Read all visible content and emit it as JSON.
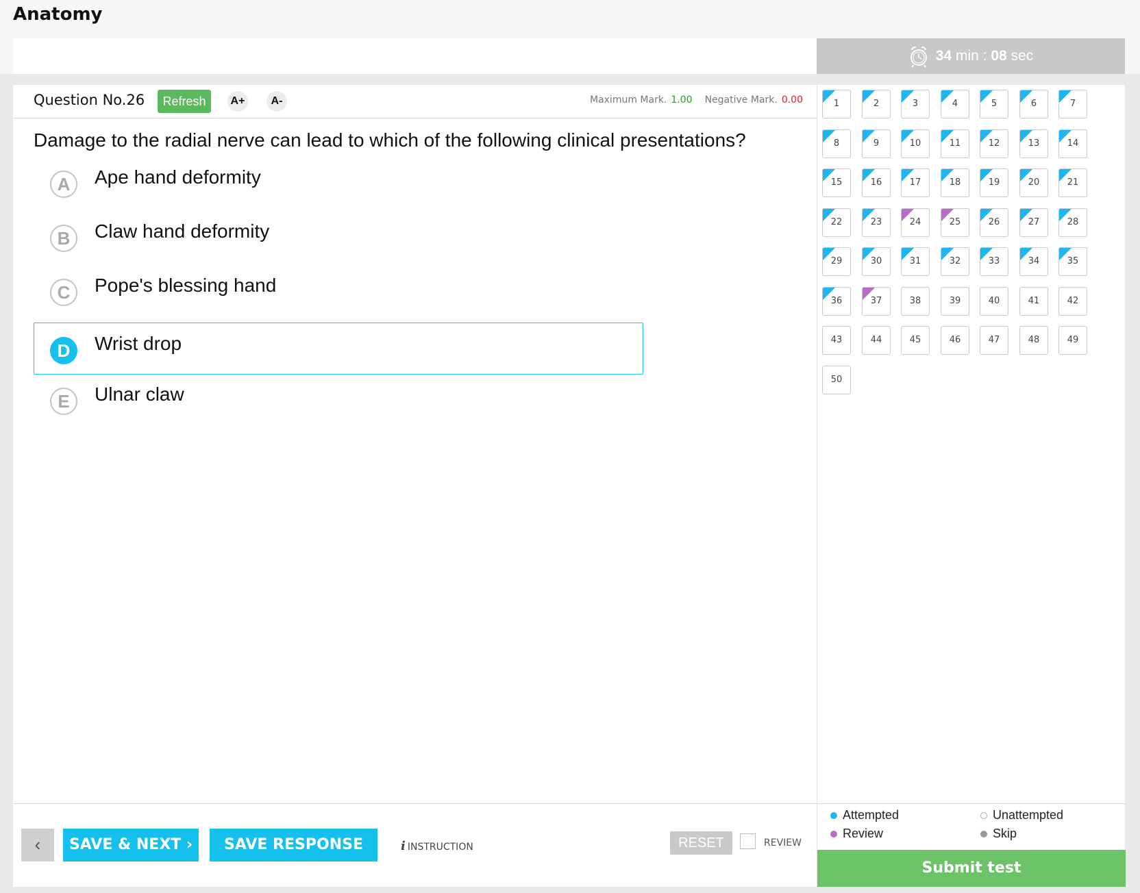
{
  "app": {
    "title": "Anatomy"
  },
  "timer": {
    "minutes": "34",
    "min_label": "min :",
    "seconds": "08",
    "sec_label": "sec",
    "icon": "alarm-clock-icon"
  },
  "question": {
    "number_label": "Question No.26",
    "refresh_label": "Refresh",
    "font_increase": "A+",
    "font_decrease": "A-",
    "max_mark_label": "Maximum Mark.",
    "max_mark_value": "1.00",
    "neg_mark_label": "Negative Mark.",
    "neg_mark_value": "0.00",
    "text": "Damage to the radial nerve can lead to which of the following clinical presentations?",
    "options": [
      {
        "letter": "A",
        "text": "Ape hand deformity",
        "selected": false
      },
      {
        "letter": "B",
        "text": "Claw hand deformity",
        "selected": false
      },
      {
        "letter": "C",
        "text": "Pope's blessing hand",
        "selected": false
      },
      {
        "letter": "D",
        "text": "Wrist drop",
        "selected": true
      },
      {
        "letter": "E",
        "text": "Ulnar claw",
        "selected": false
      }
    ]
  },
  "footer": {
    "back_icon": "chevron-left-icon",
    "back_glyph": "‹",
    "save_next_label": "SAVE & NEXT ›",
    "save_response_label": "SAVE RESPONSE",
    "instruction_icon": "i",
    "instruction_label": "INSTRUCTION",
    "reset_label": "RESET",
    "review_label": "REVIEW"
  },
  "palette": {
    "colors": {
      "attempted": "#1fb5ee",
      "review": "#b86bc7",
      "skip": "#9a9a9a",
      "accent": "#16c0ed",
      "submit": "#6cc267"
    },
    "questions": [
      {
        "n": "1",
        "s": "attempted"
      },
      {
        "n": "2",
        "s": "attempted"
      },
      {
        "n": "3",
        "s": "attempted"
      },
      {
        "n": "4",
        "s": "attempted"
      },
      {
        "n": "5",
        "s": "attempted"
      },
      {
        "n": "6",
        "s": "attempted"
      },
      {
        "n": "7",
        "s": "attempted"
      },
      {
        "n": "8",
        "s": "attempted"
      },
      {
        "n": "9",
        "s": "attempted"
      },
      {
        "n": "10",
        "s": "attempted"
      },
      {
        "n": "11",
        "s": "attempted"
      },
      {
        "n": "12",
        "s": "attempted"
      },
      {
        "n": "13",
        "s": "attempted"
      },
      {
        "n": "14",
        "s": "attempted"
      },
      {
        "n": "15",
        "s": "attempted"
      },
      {
        "n": "16",
        "s": "attempted"
      },
      {
        "n": "17",
        "s": "attempted"
      },
      {
        "n": "18",
        "s": "attempted"
      },
      {
        "n": "19",
        "s": "attempted"
      },
      {
        "n": "20",
        "s": "attempted"
      },
      {
        "n": "21",
        "s": "attempted"
      },
      {
        "n": "22",
        "s": "attempted"
      },
      {
        "n": "23",
        "s": "attempted"
      },
      {
        "n": "24",
        "s": "review"
      },
      {
        "n": "25",
        "s": "review"
      },
      {
        "n": "26",
        "s": "attempted"
      },
      {
        "n": "27",
        "s": "attempted"
      },
      {
        "n": "28",
        "s": "attempted"
      },
      {
        "n": "29",
        "s": "attempted"
      },
      {
        "n": "30",
        "s": "attempted"
      },
      {
        "n": "31",
        "s": "attempted"
      },
      {
        "n": "32",
        "s": "attempted"
      },
      {
        "n": "33",
        "s": "attempted"
      },
      {
        "n": "34",
        "s": "attempted"
      },
      {
        "n": "35",
        "s": "attempted"
      },
      {
        "n": "36",
        "s": "attempted"
      },
      {
        "n": "37",
        "s": "review"
      },
      {
        "n": "38",
        "s": "unattempted"
      },
      {
        "n": "39",
        "s": "unattempted"
      },
      {
        "n": "40",
        "s": "unattempted"
      },
      {
        "n": "41",
        "s": "unattempted"
      },
      {
        "n": "42",
        "s": "unattempted"
      },
      {
        "n": "43",
        "s": "unattempted"
      },
      {
        "n": "44",
        "s": "unattempted"
      },
      {
        "n": "45",
        "s": "unattempted"
      },
      {
        "n": "46",
        "s": "unattempted"
      },
      {
        "n": "47",
        "s": "unattempted"
      },
      {
        "n": "48",
        "s": "unattempted"
      },
      {
        "n": "49",
        "s": "unattempted"
      },
      {
        "n": "50",
        "s": "unattempted"
      }
    ]
  },
  "legend": {
    "attempted": "Attempted",
    "unattempted": "Unattempted",
    "review": "Review",
    "skip": "Skip"
  },
  "submit_label": "Submit test"
}
